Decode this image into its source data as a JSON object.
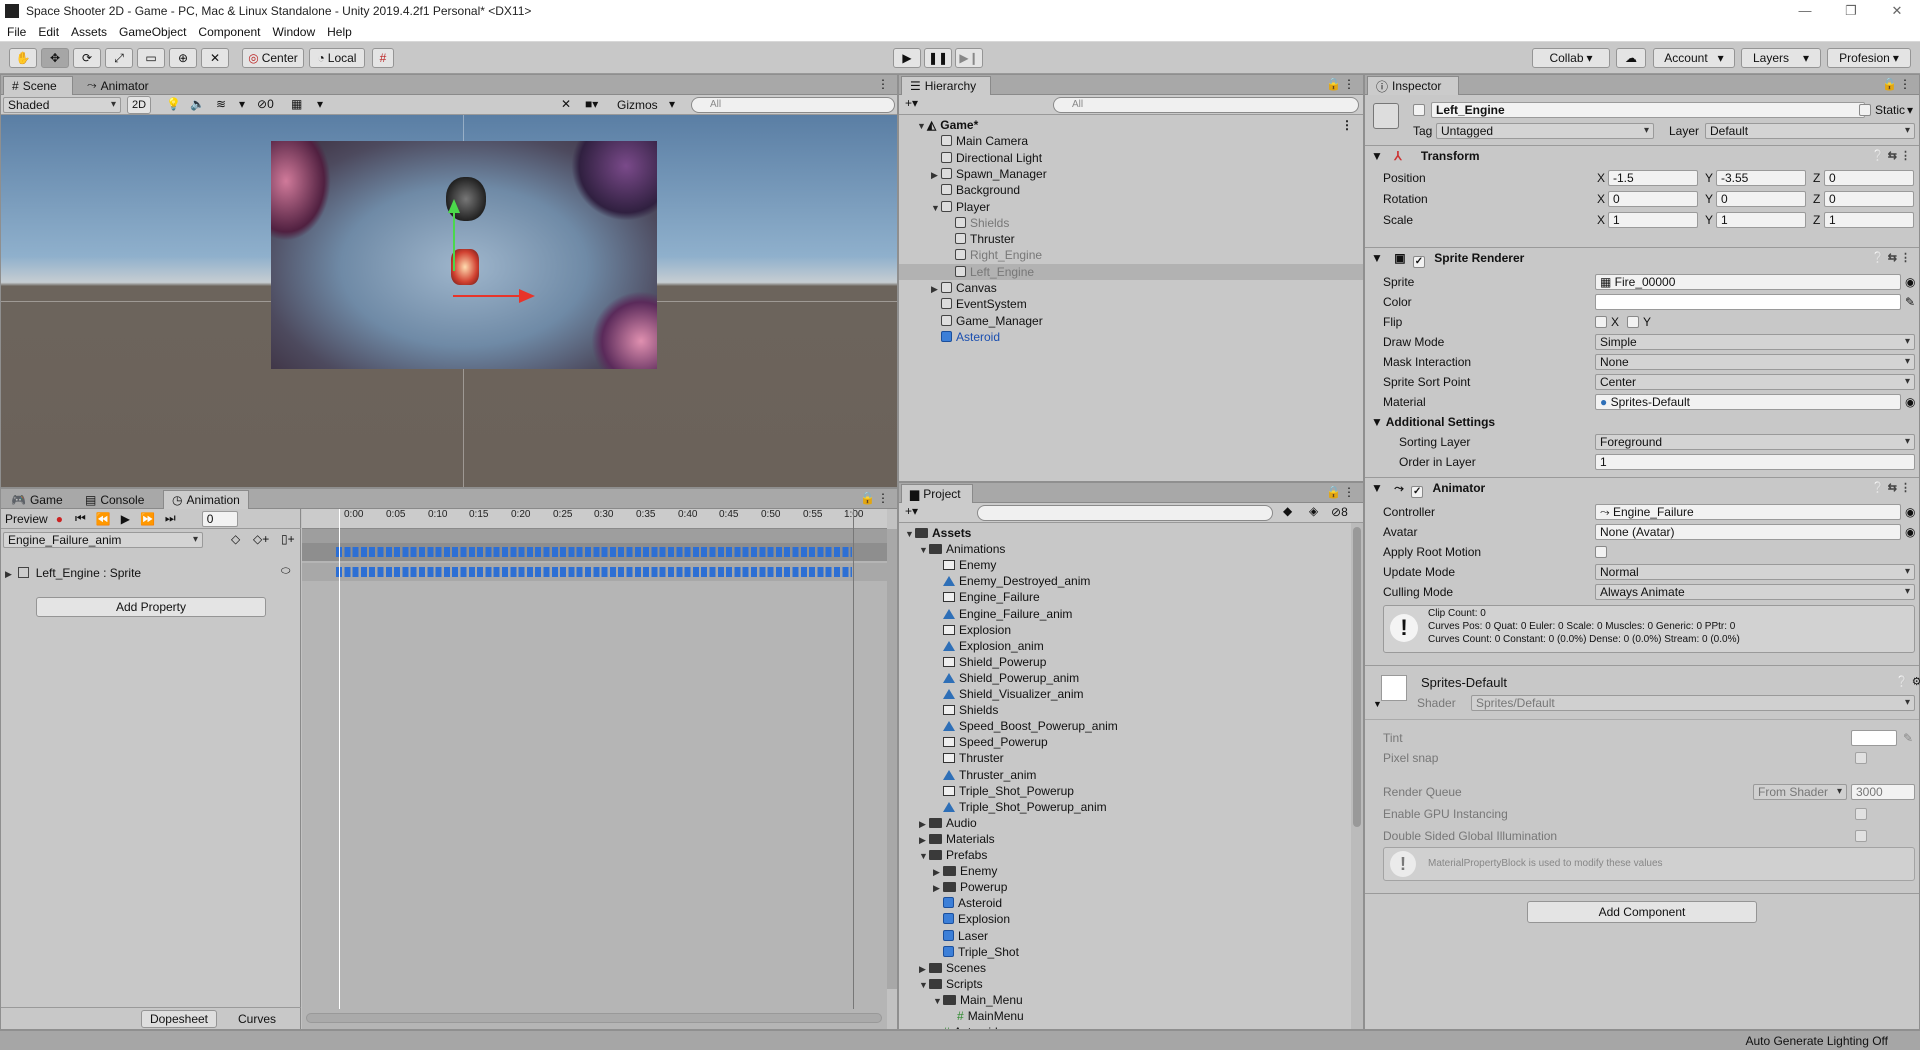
{
  "window": {
    "title": "Space Shooter 2D - Game - PC, Mac & Linux Standalone - Unity 2019.4.2f1 Personal* <DX11>",
    "minimize": "—",
    "restore": "❐",
    "close": "✕"
  },
  "menu": [
    "File",
    "Edit",
    "Assets",
    "GameObject",
    "Component",
    "Window",
    "Help"
  ],
  "toolbar": {
    "pivot": "Center",
    "space": "Local",
    "collab": "Collab",
    "account": "Account",
    "layers": "Layers",
    "layout": "Profesion"
  },
  "scene": {
    "tabs": [
      "Scene",
      "Animator"
    ],
    "shading": "Shaded",
    "mode_2d": "2D",
    "hidden_count": "0",
    "gizmos": "Gizmos",
    "search_placeholder": "All"
  },
  "hierarchy": {
    "tab": "Hierarchy",
    "search_placeholder": "All",
    "items": [
      {
        "label": "Game*",
        "depth": 0,
        "arrow": "▼",
        "icon": "unity-scene-icon",
        "bold": true
      },
      {
        "label": "Main Camera",
        "depth": 1,
        "arrow": "",
        "icon": "cube"
      },
      {
        "label": "Directional Light",
        "depth": 1,
        "arrow": "",
        "icon": "cube"
      },
      {
        "label": "Spawn_Manager",
        "depth": 1,
        "arrow": "▶",
        "icon": "cube"
      },
      {
        "label": "Background",
        "depth": 1,
        "arrow": "",
        "icon": "cube"
      },
      {
        "label": "Player",
        "depth": 1,
        "arrow": "▼",
        "icon": "cube"
      },
      {
        "label": "Shields",
        "depth": 2,
        "arrow": "",
        "icon": "cube",
        "dim": true
      },
      {
        "label": "Thruster",
        "depth": 2,
        "arrow": "",
        "icon": "cube"
      },
      {
        "label": "Right_Engine",
        "depth": 2,
        "arrow": "",
        "icon": "cube",
        "dim": true
      },
      {
        "label": "Left_Engine",
        "depth": 2,
        "arrow": "",
        "icon": "cube",
        "dim": true,
        "selected": true
      },
      {
        "label": "Canvas",
        "depth": 1,
        "arrow": "▶",
        "icon": "cube"
      },
      {
        "label": "EventSystem",
        "depth": 1,
        "arrow": "",
        "icon": "cube"
      },
      {
        "label": "Game_Manager",
        "depth": 1,
        "arrow": "",
        "icon": "cube"
      },
      {
        "label": "Asteroid",
        "depth": 1,
        "arrow": "",
        "icon": "cube-blue",
        "prefab": true
      }
    ]
  },
  "animation": {
    "tabs": [
      "Game",
      "Console",
      "Animation"
    ],
    "preview": "Preview",
    "frame": "0",
    "clip": "Engine_Failure_anim",
    "property": "Left_Engine : Sprite",
    "add_property": "Add Property",
    "ticks": [
      "0:00",
      "0:05",
      "0:10",
      "0:15",
      "0:20",
      "0:25",
      "0:30",
      "0:35",
      "0:40",
      "0:45",
      "0:50",
      "0:55",
      "1:00"
    ],
    "dopesheet": "Dopesheet",
    "curves": "Curves"
  },
  "project": {
    "tab": "Project",
    "hidden_count": "8",
    "items": [
      {
        "label": "Assets",
        "depth": 0,
        "arrow": "▼",
        "icon": "folder",
        "bold": true
      },
      {
        "label": "Animations",
        "depth": 1,
        "arrow": "▼",
        "icon": "folder"
      },
      {
        "label": "Enemy",
        "depth": 2,
        "arrow": "",
        "icon": "controller"
      },
      {
        "label": "Enemy_Destroyed_anim",
        "depth": 2,
        "arrow": "",
        "icon": "anim"
      },
      {
        "label": "Engine_Failure",
        "depth": 2,
        "arrow": "",
        "icon": "controller"
      },
      {
        "label": "Engine_Failure_anim",
        "depth": 2,
        "arrow": "",
        "icon": "anim"
      },
      {
        "label": "Explosion",
        "depth": 2,
        "arrow": "",
        "icon": "controller"
      },
      {
        "label": "Explosion_anim",
        "depth": 2,
        "arrow": "",
        "icon": "anim"
      },
      {
        "label": "Shield_Powerup",
        "depth": 2,
        "arrow": "",
        "icon": "controller"
      },
      {
        "label": "Shield_Powerup_anim",
        "depth": 2,
        "arrow": "",
        "icon": "anim"
      },
      {
        "label": "Shield_Visualizer_anim",
        "depth": 2,
        "arrow": "",
        "icon": "anim"
      },
      {
        "label": "Shields",
        "depth": 2,
        "arrow": "",
        "icon": "controller"
      },
      {
        "label": "Speed_Boost_Powerup_anim",
        "depth": 2,
        "arrow": "",
        "icon": "anim"
      },
      {
        "label": "Speed_Powerup",
        "depth": 2,
        "arrow": "",
        "icon": "controller"
      },
      {
        "label": "Thruster",
        "depth": 2,
        "arrow": "",
        "icon": "controller"
      },
      {
        "label": "Thruster_anim",
        "depth": 2,
        "arrow": "",
        "icon": "anim"
      },
      {
        "label": "Triple_Shot_Powerup",
        "depth": 2,
        "arrow": "",
        "icon": "controller"
      },
      {
        "label": "Triple_Shot_Powerup_anim",
        "depth": 2,
        "arrow": "",
        "icon": "anim"
      },
      {
        "label": "Audio",
        "depth": 1,
        "arrow": "▶",
        "icon": "folder"
      },
      {
        "label": "Materials",
        "depth": 1,
        "arrow": "▶",
        "icon": "folder"
      },
      {
        "label": "Prefabs",
        "depth": 1,
        "arrow": "▼",
        "icon": "folder"
      },
      {
        "label": "Enemy",
        "depth": 2,
        "arrow": "▶",
        "icon": "folder"
      },
      {
        "label": "Powerup",
        "depth": 2,
        "arrow": "▶",
        "icon": "folder"
      },
      {
        "label": "Asteroid",
        "depth": 2,
        "arrow": "",
        "icon": "cube-blue"
      },
      {
        "label": "Explosion",
        "depth": 2,
        "arrow": "",
        "icon": "cube-blue"
      },
      {
        "label": "Laser",
        "depth": 2,
        "arrow": "",
        "icon": "cube-blue"
      },
      {
        "label": "Triple_Shot",
        "depth": 2,
        "arrow": "",
        "icon": "cube-blue"
      },
      {
        "label": "Scenes",
        "depth": 1,
        "arrow": "▶",
        "icon": "folder"
      },
      {
        "label": "Scripts",
        "depth": 1,
        "arrow": "▼",
        "icon": "folder"
      },
      {
        "label": "Main_Menu",
        "depth": 2,
        "arrow": "▼",
        "icon": "folder"
      },
      {
        "label": "MainMenu",
        "depth": 3,
        "arrow": "",
        "icon": "script"
      },
      {
        "label": "Asteroid",
        "depth": 2,
        "arrow": "",
        "icon": "script"
      }
    ]
  },
  "inspector": {
    "tab": "Inspector",
    "object_name": "Left_Engine",
    "static": "Static",
    "tag_label": "Tag",
    "tag": "Untagged",
    "layer_label": "Layer",
    "layer": "Default",
    "transform": {
      "title": "Transform",
      "rows": [
        {
          "label": "Position",
          "x": "-1.5",
          "y": "-3.55",
          "z": "0"
        },
        {
          "label": "Rotation",
          "x": "0",
          "y": "0",
          "z": "0"
        },
        {
          "label": "Scale",
          "x": "1",
          "y": "1",
          "z": "1"
        }
      ]
    },
    "sprite_renderer": {
      "title": "Sprite Renderer",
      "sprite_label": "Sprite",
      "sprite": "Fire_00000",
      "color_label": "Color",
      "flip_label": "Flip",
      "flip_x": "X",
      "flip_y": "Y",
      "draw_mode_label": "Draw Mode",
      "draw_mode": "Simple",
      "mask_label": "Mask Interaction",
      "mask": "None",
      "sort_point_label": "Sprite Sort Point",
      "sort_point": "Center",
      "material_label": "Material",
      "material": "Sprites-Default",
      "additional": "Additional Settings",
      "sorting_layer_label": "Sorting Layer",
      "sorting_layer": "Foreground",
      "order_label": "Order in Layer",
      "order": "1"
    },
    "animator": {
      "title": "Animator",
      "controller_label": "Controller",
      "controller": "Engine_Failure",
      "avatar_label": "Avatar",
      "avatar": "None (Avatar)",
      "root_motion_label": "Apply Root Motion",
      "update_label": "Update Mode",
      "update": "Normal",
      "culling_label": "Culling Mode",
      "culling": "Always Animate",
      "info1": "Clip Count: 0",
      "info2": "Curves Pos: 0 Quat: 0 Euler: 0 Scale: 0 Muscles: 0 Generic: 0 PPtr: 0",
      "info3": "Curves Count: 0 Constant: 0 (0.0%) Dense: 0 (0.0%) Stream: 0 (0.0%)"
    },
    "material": {
      "name": "Sprites-Default",
      "shader_label": "Shader",
      "shader": "Sprites/Default",
      "tint_label": "Tint",
      "pixel_snap_label": "Pixel snap",
      "render_queue_label": "Render Queue",
      "render_queue_mode": "From Shader",
      "render_queue": "3000",
      "gpu_label": "Enable GPU Instancing",
      "dsgi_label": "Double Sided Global Illumination",
      "note": "MaterialPropertyBlock is used to modify these values"
    },
    "add_component": "Add Component"
  },
  "status": "Auto Generate Lighting Off"
}
